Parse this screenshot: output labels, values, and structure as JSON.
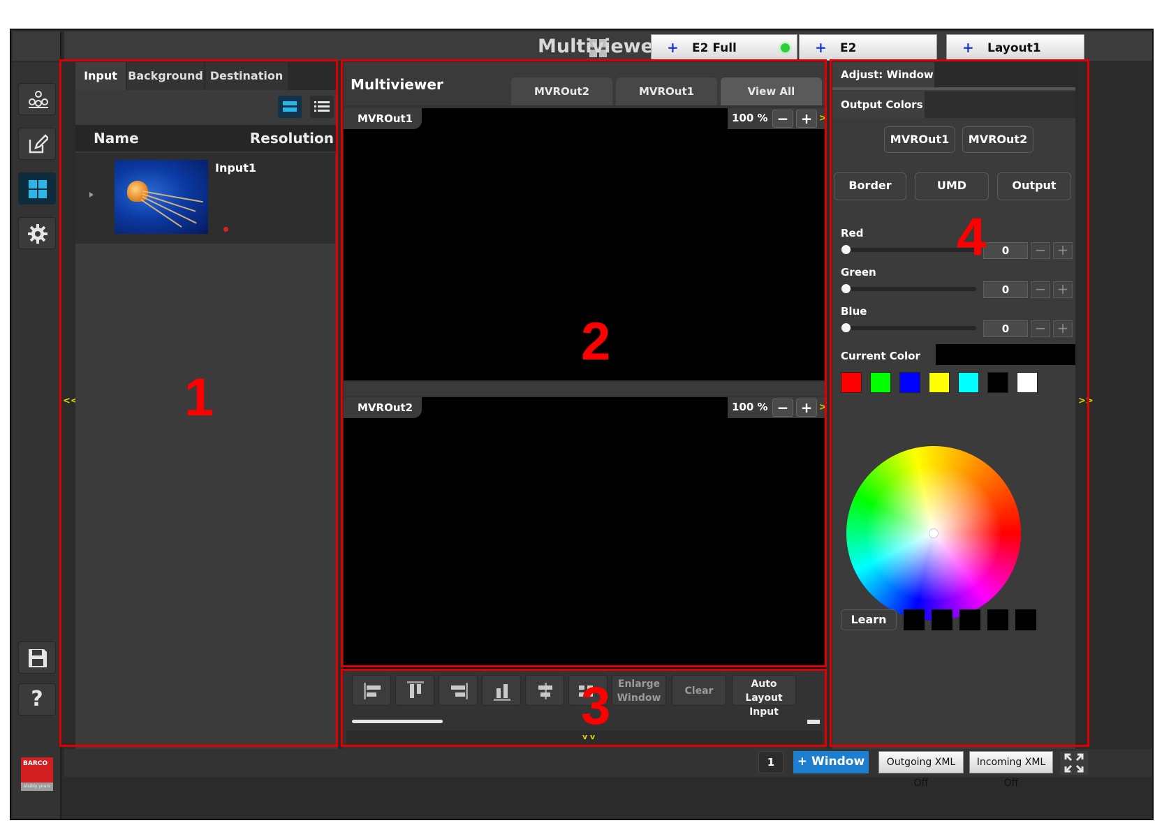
{
  "header": {
    "title": "Multiviewer",
    "tabs": [
      {
        "plus": "+",
        "label": "E2 Full"
      },
      {
        "plus": "+",
        "label": "E2"
      },
      {
        "plus": "+",
        "label": "Layout1"
      }
    ],
    "status_color": "#2fcf3a"
  },
  "nav": {
    "items": [
      {
        "name": "system-icon"
      },
      {
        "name": "edit-icon"
      },
      {
        "name": "multiviewer-icon"
      },
      {
        "name": "gear-icon"
      }
    ],
    "save_icon": "floppy-disk-icon",
    "help_label": "?",
    "logo_text": "BARCO",
    "logo_sub": "Visibly yours"
  },
  "panel1": {
    "tabs": [
      "Input",
      "Background",
      "Destination"
    ],
    "active_tab": "Input",
    "table_headers": {
      "name": "Name",
      "resolution": "Resolution"
    },
    "rows": [
      {
        "name": "Input1",
        "resolution": ""
      }
    ],
    "collapse_left": "<<"
  },
  "panel2": {
    "title": "Multiviewer",
    "tabs": [
      "MVROut2",
      "MVROut1",
      "View All"
    ],
    "active_tab": "View All",
    "outputs": [
      {
        "label": "MVROut1",
        "zoom": "100 %",
        "minus": "−",
        "plus": "+",
        "more": ">"
      },
      {
        "label": "MVROut2",
        "zoom": "100 %",
        "minus": "−",
        "plus": "+",
        "more": ">"
      }
    ],
    "expand_down": "v v"
  },
  "panel3": {
    "tools": [
      {
        "name": "align-left-icon"
      },
      {
        "name": "align-top-icon"
      },
      {
        "name": "align-right-icon"
      },
      {
        "name": "align-bottom-icon"
      },
      {
        "name": "align-center-icon"
      },
      {
        "name": "distribute-icon"
      }
    ],
    "enlarge_label": "Enlarge Window",
    "clear_label": "Clear",
    "auto_layout_label": "Auto Layout Input"
  },
  "panel4": {
    "header": "Adjust: Window",
    "section_tab": "Output Colors",
    "output_buttons": [
      "MVROut1",
      "MVROut2"
    ],
    "mode_buttons": [
      "Border",
      "UMD",
      "Output"
    ],
    "channels": [
      {
        "label": "Red",
        "value": "0",
        "level": 0
      },
      {
        "label": "Green",
        "value": "0",
        "level": 0
      },
      {
        "label": "Blue",
        "value": "0",
        "level": 0
      }
    ],
    "minus": "−",
    "plus": "+",
    "current_color_label": "Current Color",
    "current_color": "#000000",
    "presets": [
      "#ff0000",
      "#00ff00",
      "#0000ff",
      "#ffff00",
      "#00ffff",
      "#000000",
      "#ffffff"
    ],
    "learn_label": "Learn",
    "learned": [
      "#000000",
      "#000000",
      "#000000",
      "#000000",
      "#000000"
    ],
    "collapse_right": ">>"
  },
  "footer": {
    "page": "1",
    "window_button": "+ Window",
    "window_color": "#1e7fd0",
    "outgoing_xml": "Outgoing XML Off",
    "incoming_xml": "Incoming XML Off",
    "fullscreen_icon": "fullscreen-icon"
  },
  "annotations": [
    "1",
    "2",
    "3",
    "4"
  ]
}
